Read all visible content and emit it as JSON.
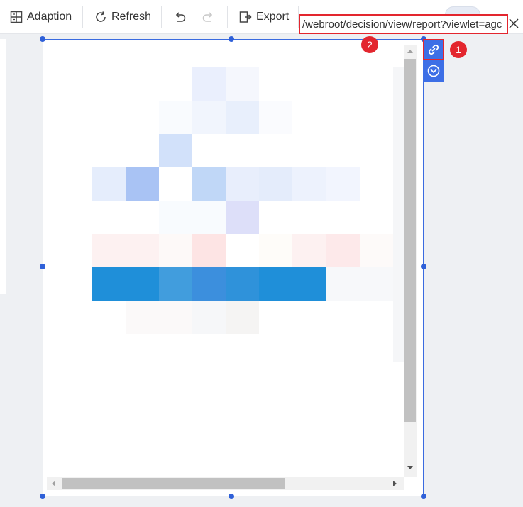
{
  "toolbar": {
    "adaption_label": "Adaption",
    "refresh_label": "Refresh",
    "export_label": "Export"
  },
  "url_bar": {
    "value": "/webroot/decision/view/report?viewlet=agc"
  },
  "annotations": {
    "badge_1": "1",
    "badge_2": "2"
  },
  "colors": {
    "accent": "#3d6fe6",
    "highlight": "#e3262e",
    "selection": "#3a6be0"
  },
  "icons": [
    "adaption-icon",
    "refresh-icon",
    "undo-icon",
    "redo-icon",
    "export-icon",
    "close-icon",
    "link-icon",
    "chevron-down-circle-icon"
  ]
}
